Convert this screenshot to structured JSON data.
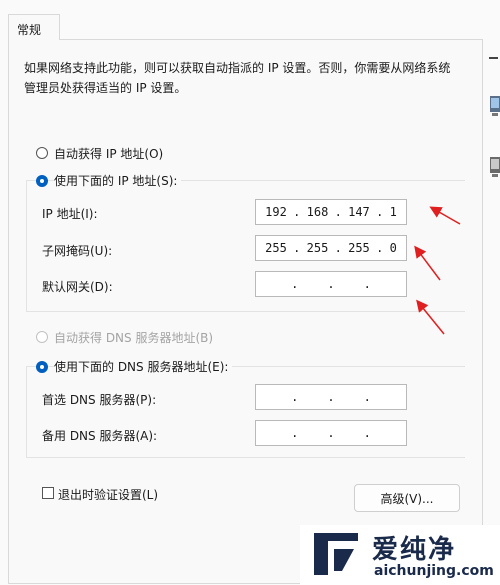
{
  "tab": {
    "label": "常规"
  },
  "description": "如果网络支持此功能，则可以获取自动指派的 IP 设置。否则，你需要从网络系统管理员处获得适当的 IP 设置。",
  "ip_section": {
    "auto_label": "自动获得 IP 地址(O)",
    "manual_label": "使用下面的 IP 地址(S):",
    "ip_label": "IP 地址(I):",
    "ip_value": [
      "192",
      "168",
      "147",
      "1"
    ],
    "mask_label": "子网掩码(U):",
    "mask_value": [
      "255",
      "255",
      "255",
      "0"
    ],
    "gateway_label": "默认网关(D):",
    "gateway_value": [
      ".",
      ".",
      "."
    ]
  },
  "dns_section": {
    "auto_label": "自动获得 DNS 服务器地址(B)",
    "manual_label": "使用下面的 DNS 服务器地址(E):",
    "preferred_label": "首选 DNS 服务器(P):",
    "preferred_value": [
      ".",
      ".",
      "."
    ],
    "alternate_label": "备用 DNS 服务器(A):",
    "alternate_value": [
      ".",
      ".",
      "."
    ]
  },
  "validate_label": "退出时验证设置(L)",
  "advanced_button": "高级(V)...",
  "watermark": {
    "brand": "爱纯净",
    "url": "aichunjing.com"
  },
  "colors": {
    "accent": "#0060c0",
    "arrow": "#e02020",
    "logo": "#1a2a4a"
  }
}
